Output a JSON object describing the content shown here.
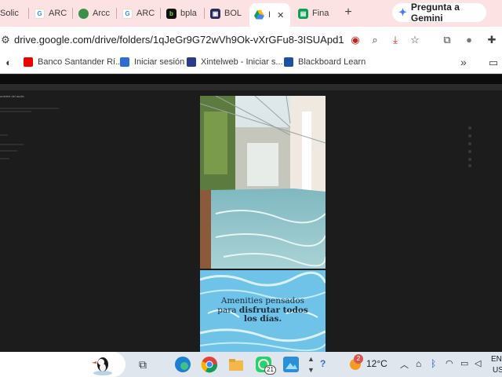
{
  "tabs": [
    {
      "label": "Solic",
      "icon": "page-icon"
    },
    {
      "label": "ARC",
      "icon": "google-icon"
    },
    {
      "label": "Arcc",
      "icon": "globe-icon"
    },
    {
      "label": "ARC",
      "icon": "google-icon"
    },
    {
      "label": "bpla",
      "icon": "b-app-icon"
    },
    {
      "label": "BOL",
      "icon": "bol-icon"
    },
    {
      "label": "I",
      "icon": "drive-icon",
      "active": true
    },
    {
      "label": "Fina",
      "icon": "sheets-icon"
    }
  ],
  "tab_close_glyph": "✕",
  "new_tab_glyph": "+",
  "gemini_label": "Pregunta a Gemini",
  "address": {
    "url": "drive.google.com/drive/folders/1qJeGr9G72wVh9Ok-vXrGFu8-3ISUApd1"
  },
  "bookmarks": [
    {
      "label": "Banco Santander Rí...",
      "icon": "santander-icon",
      "color": "#ec0000"
    },
    {
      "label": "Iniciar sesión",
      "icon": "mail-icon",
      "color": "#2b6fd6"
    },
    {
      "label": "Xintelweb - Iniciar s...",
      "icon": "xintelweb-icon",
      "color": "#2d3a8c"
    },
    {
      "label": "Blackboard Learn",
      "icon": "blackboard-icon",
      "color": "#1e4fa0"
    }
  ],
  "bookmarks_more_glyph": "»",
  "viewer": {
    "file_title": "umbiert del audio"
  },
  "slide_text": {
    "line1": "Amenities pensados",
    "line2_pre": "para ",
    "line2_bold": "disfrutar todos",
    "line3": "los días."
  },
  "taskbar": {
    "whatsapp_badge": "21",
    "weather_badge": "2",
    "temperature": "12°C",
    "language": "ENG",
    "region": "US"
  },
  "colors": {
    "tabstrip": "#fde2e4",
    "viewer_bg": "#1c1c1c",
    "taskbar": "#dfe6ee"
  }
}
